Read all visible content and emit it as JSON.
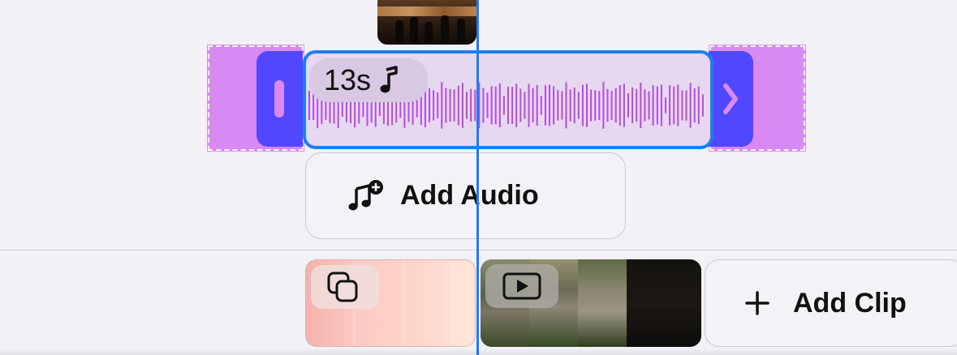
{
  "timeline": {
    "audio_clip": {
      "duration": "13s",
      "icon": "music-note-icon"
    },
    "add_audio": {
      "label": "Add Audio",
      "icon": "music-note-plus-icon"
    },
    "clips": [
      {
        "kind": "image",
        "icon": "overlapping-squares-icon"
      },
      {
        "kind": "video",
        "icon": "play-rectangle-icon"
      }
    ],
    "add_clip": {
      "label": "Add Clip",
      "icon": "plus-icon"
    }
  },
  "colors": {
    "background": "#f2f1f6",
    "selection_blue": "#1f7ef0",
    "trim_handle": "#5147ff",
    "audio_accent": "#d98af2",
    "waveform": "#b44ddc",
    "playhead": "#1a7ff2"
  }
}
